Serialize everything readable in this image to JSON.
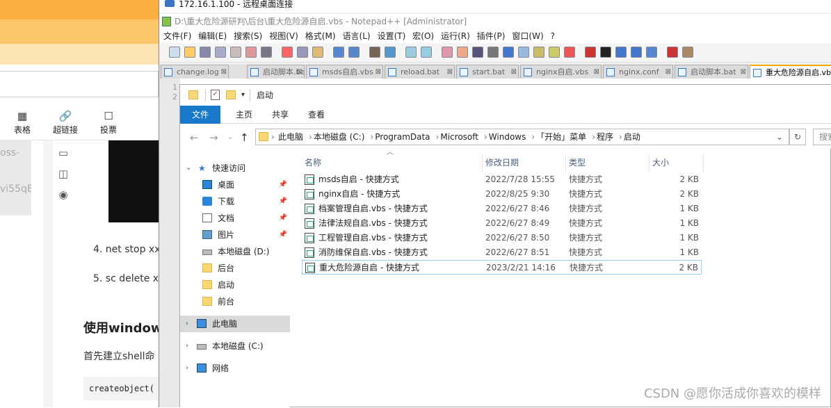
{
  "bg_editor": {
    "tools": [
      {
        "icon": "table-icon",
        "glyph": "▦",
        "label": "表格"
      },
      {
        "icon": "link-icon",
        "glyph": "🔗",
        "label": "超链接"
      },
      {
        "icon": "vote-icon",
        "glyph": "☐",
        "label": "投票"
      }
    ],
    "left_snippets": [
      "oss-",
      "vi55qE"
    ],
    "side_icons": [
      {
        "icon": "panel-icon",
        "glyph": "▭"
      },
      {
        "icon": "columns-icon",
        "glyph": "◫"
      },
      {
        "icon": "eye-icon",
        "glyph": "◉"
      }
    ],
    "list_item_4": "4. net stop xx",
    "list_item_5": "5. sc delete x",
    "heading": "使用window",
    "para": "首先建立shell命",
    "code": "createobject("
  },
  "rdp": {
    "title": "172.16.1.100 - 远程桌面连接"
  },
  "npp": {
    "title": "D:\\重大危险源研判\\后台\\重大危险源自启.vbs - Notepad++ [Administrator]",
    "menu": [
      "文件(F)",
      "编辑(E)",
      "搜索(S)",
      "视图(V)",
      "格式(M)",
      "语言(L)",
      "设置(T)",
      "宏(O)",
      "运行(R)",
      "插件(P)",
      "窗口(W)",
      "?"
    ],
    "tabs": [
      {
        "label": "change.log",
        "active": false
      },
      {
        "label": "启动脚本.bat",
        "active": false
      },
      {
        "label": "msds自启.vbs",
        "active": false
      },
      {
        "label": "reload.bat",
        "active": false
      },
      {
        "label": "start.bat",
        "active": false
      },
      {
        "label": "nginx自启.vbs",
        "active": false
      },
      {
        "label": "nginx.conf",
        "active": false
      },
      {
        "label": "启动脚本.bat",
        "active": false
      },
      {
        "label": "重大危险源自启.vbs",
        "active": true
      }
    ],
    "line_numbers": [
      "1",
      "2"
    ]
  },
  "explorer": {
    "qat_title": "启动",
    "ribbon_tabs": [
      "文件",
      "主页",
      "共享",
      "查看"
    ],
    "breadcrumb": [
      "此电脑",
      "本地磁盘 (C:)",
      "ProgramData",
      "Microsoft",
      "Windows",
      "「开始」菜单",
      "程序",
      "启动"
    ],
    "search_placeholder": "搜索",
    "nav": {
      "quick_access": "快速访问",
      "items": [
        {
          "label": "桌面",
          "icon": "desktop-icon",
          "pinned": true
        },
        {
          "label": "下载",
          "icon": "download-icon",
          "pinned": true
        },
        {
          "label": "文档",
          "icon": "document-icon",
          "pinned": true
        },
        {
          "label": "图片",
          "icon": "picture-icon",
          "pinned": true
        },
        {
          "label": "本地磁盘 (D:)",
          "icon": "drive-icon",
          "pinned": false
        },
        {
          "label": "后台",
          "icon": "folder-icon",
          "pinned": false
        },
        {
          "label": "启动",
          "icon": "folder-icon",
          "pinned": false
        },
        {
          "label": "前台",
          "icon": "folder-icon",
          "pinned": false
        }
      ],
      "this_pc": "此电脑",
      "local_c": "本地磁盘 (C:)",
      "network": "网络"
    },
    "columns": {
      "name": "名称",
      "date": "修改日期",
      "type": "类型",
      "size": "大小"
    },
    "files": [
      {
        "name": "msds自启 - 快捷方式",
        "date": "2022/7/28 15:55",
        "type": "快捷方式",
        "size": "2 KB"
      },
      {
        "name": "nginx自启 - 快捷方式",
        "date": "2022/8/25 9:30",
        "type": "快捷方式",
        "size": "2 KB"
      },
      {
        "name": "档案管理自启.vbs - 快捷方式",
        "date": "2022/6/27 8:46",
        "type": "快捷方式",
        "size": "1 KB"
      },
      {
        "name": "法律法规自启.vbs - 快捷方式",
        "date": "2022/6/27 8:49",
        "type": "快捷方式",
        "size": "1 KB"
      },
      {
        "name": "工程管理自启.vbs - 快捷方式",
        "date": "2022/6/27 8:50",
        "type": "快捷方式",
        "size": "1 KB"
      },
      {
        "name": "消防维保自启.vbs - 快捷方式",
        "date": "2022/6/27 8:51",
        "type": "快捷方式",
        "size": "1 KB"
      },
      {
        "name": "重大危险源自启 - 快捷方式",
        "date": "2023/2/21 14:16",
        "type": "快捷方式",
        "size": "2 KB"
      }
    ],
    "selected_index": 6
  },
  "watermark": "CSDN @愿你活成你喜欢的模样"
}
